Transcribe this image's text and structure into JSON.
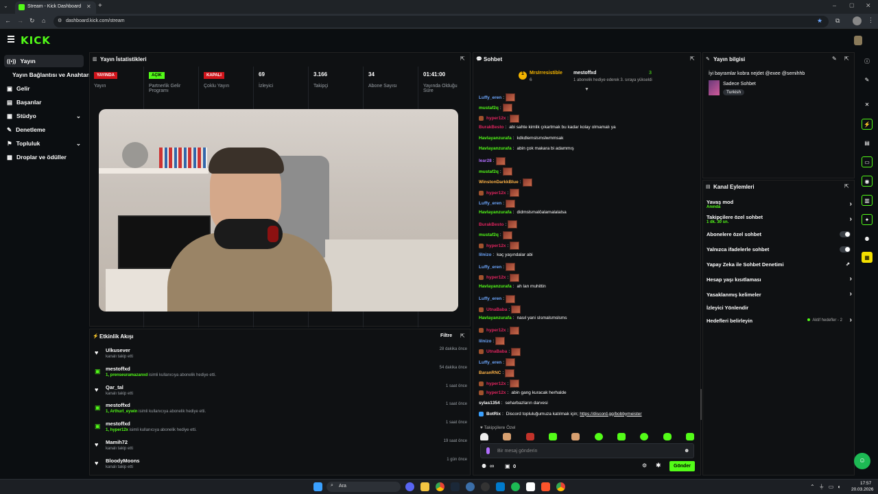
{
  "browser": {
    "tab_title": "Stream - Kick Dashboard",
    "url": "dashboard.kick.com/stream"
  },
  "brand": {
    "logo": "KICK",
    "accent": "#53fc18"
  },
  "sidebar": {
    "items": [
      {
        "label": "Yayın",
        "icon": "broadcast-icon"
      },
      {
        "label": "Yayın Bağlantısı ve Anahtarı",
        "icon": ""
      },
      {
        "label": "Gelir",
        "icon": "wallet-icon"
      },
      {
        "label": "Başarılar",
        "icon": "trophy-icon"
      },
      {
        "label": "Stüdyo",
        "icon": "studio-icon"
      },
      {
        "label": "Denetleme",
        "icon": "wrench-icon"
      },
      {
        "label": "Topluluk",
        "icon": "community-icon"
      },
      {
        "label": "Droplar ve ödüller",
        "icon": "gift-icon"
      }
    ]
  },
  "stats": {
    "title": "Yayın İstatistikleri",
    "items": [
      {
        "value": "YAYINDA",
        "label": "Yayın",
        "kind": "red"
      },
      {
        "value": "AÇIK",
        "label": "Partnerlik Gelir Programı",
        "kind": "green"
      },
      {
        "value": "KAPALI",
        "label": "Çoklu Yayın",
        "kind": "red"
      },
      {
        "value": "69",
        "label": "İzleyici",
        "kind": "num"
      },
      {
        "value": "3.166",
        "label": "Takipçi",
        "kind": "num"
      },
      {
        "value": "34",
        "label": "Abone Sayısı",
        "kind": "num"
      },
      {
        "value": "01:41:00",
        "label": "Yayında Olduğu Süre",
        "kind": "num"
      }
    ]
  },
  "activity": {
    "title": "Etkinlik Akışı",
    "filter": "Filtre",
    "rows": [
      {
        "name": "Ulkusever",
        "sub": "kanalı takip etti",
        "time": "28 dakika önce",
        "icon": "heart-icon",
        "sub_user": ""
      },
      {
        "name": "mestoffxd",
        "sub_user": "1, prenseuramazanxd",
        "sub": " isimli kullanıcıya abonelik hediye etti.",
        "time": "54 dakika önce",
        "icon": "gift-icon"
      },
      {
        "name": "Qar_tal",
        "sub": "kanalı takip etti",
        "time": "1 saat önce",
        "icon": "heart-icon",
        "sub_user": ""
      },
      {
        "name": "mestoffxd",
        "sub_user": "1, Arthurl_eywin",
        "sub": " isimli kullanıcıya abonelik hediye etti.",
        "time": "1 saat önce",
        "icon": "gift-icon"
      },
      {
        "name": "mestoffxd",
        "sub_user": "1, hyper12x",
        "sub": " isimli kullanıcıya abonelik hediye etti.",
        "time": "1 saat önce",
        "icon": "gift-icon"
      },
      {
        "name": "Mamih72",
        "sub": "kanalı takip etti",
        "time": "19 saat önce",
        "icon": "heart-icon",
        "sub_user": ""
      },
      {
        "name": "BloodyMoons",
        "sub": "kanalı takip etti",
        "time": "1 gün önce",
        "icon": "heart-icon",
        "sub_user": ""
      }
    ]
  },
  "chat": {
    "title": "Sohbet",
    "pinned": {
      "user": "MrsIrresistible",
      "count": "6",
      "gifter": "mestoffxd",
      "gift_count": "3",
      "text": "1 abonelik hediye ederek 3. sıraya yükseldi"
    },
    "messages": [
      {
        "user": "Luffy_eren",
        "color": "#6ea8ff",
        "text": "",
        "emote": true,
        "badge": false
      },
      {
        "user": "mustaf2q",
        "color": "#53fc18",
        "text": "",
        "emote": true,
        "badge": false
      },
      {
        "user": "hyper12x",
        "color": "#e0245e",
        "text": "",
        "emote": true,
        "badge": true
      },
      {
        "user": "BurakBesto",
        "color": "#e0245e",
        "text": "abi sahte kimlik çıkartmak bu kadar kolay olmamalı ya",
        "emote": false,
        "badge": false
      },
      {
        "user": "Havlayanzurafa",
        "color": "#53fc18",
        "text": "kdkdlemslsmslwmmsak",
        "emote": false,
        "badge": false
      },
      {
        "user": "Havlayanzurafa",
        "color": "#53fc18",
        "text": "abin çok makara bi adammış",
        "emote": false,
        "badge": false
      },
      {
        "user": "lear28",
        "color": "#b26eff",
        "text": "",
        "emote": true,
        "badge": false
      },
      {
        "user": "mustaf2q",
        "color": "#53fc18",
        "text": "",
        "emote": true,
        "badge": false
      },
      {
        "user": "WinstonDarkkBlue",
        "color": "#ffb347",
        "text": "",
        "emote": true,
        "badge": false
      },
      {
        "user": "hyper12x",
        "color": "#e0245e",
        "text": "",
        "emote": true,
        "badge": true
      },
      {
        "user": "Luffy_eren",
        "color": "#6ea8ff",
        "text": "",
        "emote": true,
        "badge": false
      },
      {
        "user": "Havlayanzurafa",
        "color": "#53fc18",
        "text": "didmslsmalöalamalalalsa",
        "emote": false,
        "badge": false
      },
      {
        "user": "BurakBesto",
        "color": "#e0245e",
        "text": "",
        "emote": true,
        "badge": false
      },
      {
        "user": "mustaf2q",
        "color": "#53fc18",
        "text": "",
        "emote": true,
        "badge": false
      },
      {
        "user": "hyper12x",
        "color": "#e0245e",
        "text": "",
        "emote": true,
        "badge": true
      },
      {
        "user": "lilnizo",
        "color": "#6ea8ff",
        "text": "kaç yaşındalar abi",
        "emote": false,
        "badge": false
      },
      {
        "user": "Luffy_eren",
        "color": "#6ea8ff",
        "text": "",
        "emote": true,
        "badge": false
      },
      {
        "user": "hyper12x",
        "color": "#e0245e",
        "text": "",
        "emote": true,
        "badge": true
      },
      {
        "user": "Havlayanzurafa",
        "color": "#53fc18",
        "text": "ah lan muhittin",
        "emote": false,
        "badge": false
      },
      {
        "user": "Luffy_eren",
        "color": "#6ea8ff",
        "text": "",
        "emote": true,
        "badge": false
      },
      {
        "user": "UtnaBaba",
        "color": "#e0245e",
        "text": "",
        "emote": true,
        "badge": true
      },
      {
        "user": "Havlayanzurafa",
        "color": "#53fc18",
        "text": "nasıl yani slsmalsmslsms",
        "emote": false,
        "badge": false
      },
      {
        "user": "hyper12x",
        "color": "#e0245e",
        "text": "",
        "emote": true,
        "badge": true
      },
      {
        "user": "lilnizo",
        "color": "#6ea8ff",
        "text": "",
        "emote": true,
        "badge": false
      },
      {
        "user": "UtnaBaba",
        "color": "#e0245e",
        "text": "",
        "emote": true,
        "badge": true
      },
      {
        "user": "Luffy_eren",
        "color": "#6ea8ff",
        "text": "",
        "emote": true,
        "badge": false
      },
      {
        "user": "BaranRNC",
        "color": "#ffb347",
        "text": "",
        "emote": true,
        "badge": false
      },
      {
        "user": "hyper12x",
        "color": "#e0245e",
        "text": "",
        "emote": true,
        "badge": true
      },
      {
        "user": "hyper12x",
        "color": "#e0245e",
        "text": "abin gang kuracak herhalde",
        "emote": false,
        "badge": true
      },
      {
        "user": "sylas1354",
        "color": "#ffffff",
        "text": "seharbazların darvesi",
        "emote": false,
        "badge": false
      },
      {
        "user": "BotRix",
        "color": "#ffffff",
        "text": "Discord topluluğumuza katılmak için; ",
        "link": "https://discord.gg/bobbymeister",
        "emote": false,
        "badge": true
      }
    ],
    "followers_only": "Takipçilere Özel",
    "input_placeholder": "Bir mesaj gönderin",
    "send": "Gönder",
    "points": "∞",
    "gift_count": "0"
  },
  "stream_info": {
    "title": "Yayın bilgisi",
    "stream_title": "İyi bayramlar kobra nejdet @exee @semihhb",
    "category": "Sadece Sohbet",
    "tag": "Turkish"
  },
  "channel_actions": {
    "title": "Kanal Eylemleri",
    "items": [
      {
        "label": "Yavaş mod",
        "sub": "Anında",
        "control": "chevron"
      },
      {
        "label": "Takipçilere özel sohbet",
        "sub": "1 dk. 30 sn.",
        "control": "chevron"
      },
      {
        "label": "Abonelere özel sohbet",
        "sub": "",
        "control": "toggle"
      },
      {
        "label": "Yalnızca ifadelerle sohbet",
        "sub": "",
        "control": "toggle"
      },
      {
        "label": "Yapay Zeka ile Sohbet Denetimi",
        "sub": "",
        "control": "external"
      },
      {
        "label": "Hesap yaşı kısıtlaması",
        "sub": "",
        "control": "chevron"
      },
      {
        "label": "Yasaklanmış kelimeler",
        "sub": "",
        "control": "chevron"
      },
      {
        "label": "İzleyici Yönlendir",
        "sub": "",
        "control": "none"
      },
      {
        "label": "Hedefleri belirleyin",
        "sub": "",
        "control": "goal",
        "goal_text": "Aktif hedefler - 2"
      }
    ]
  },
  "taskbar": {
    "search": "Ara",
    "time": "17:57",
    "date": "20.03.2026"
  }
}
